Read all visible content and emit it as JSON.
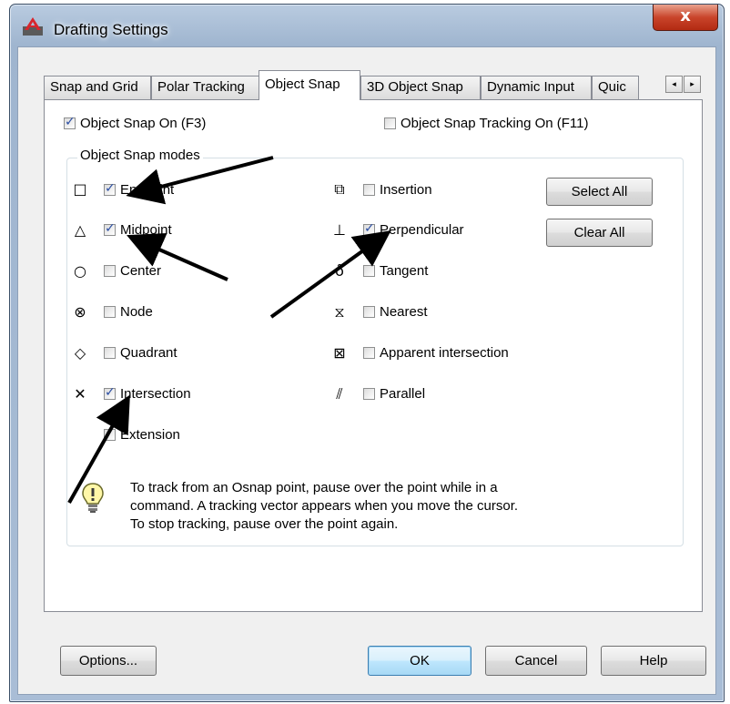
{
  "window": {
    "title": "Drafting Settings",
    "close_label": "x"
  },
  "tabs": [
    {
      "label": "Snap and Grid",
      "active": false
    },
    {
      "label": "Polar Tracking",
      "active": false
    },
    {
      "label": "Object Snap",
      "active": true
    },
    {
      "label": "3D Object Snap",
      "active": false
    },
    {
      "label": "Dynamic Input",
      "active": false
    },
    {
      "label": "Quic",
      "active": false
    }
  ],
  "tab_scroll": {
    "left": "◂",
    "right": "▸"
  },
  "object_snap": {
    "snap_on": {
      "label": "Object Snap On (F3)",
      "checked": true
    },
    "tracking_on": {
      "label": "Object Snap Tracking On (F11)",
      "checked": false
    },
    "group_label": "Object Snap modes",
    "modes_left": [
      {
        "label": "Endpoint",
        "checked": true,
        "symbol": "□",
        "icon": "square-icon"
      },
      {
        "label": "Midpoint",
        "checked": true,
        "symbol": "△",
        "icon": "triangle-icon"
      },
      {
        "label": "Center",
        "checked": false,
        "symbol": "○",
        "icon": "circle-icon"
      },
      {
        "label": "Node",
        "checked": false,
        "symbol": "⊗",
        "icon": "node-icon"
      },
      {
        "label": "Quadrant",
        "checked": false,
        "symbol": "◇",
        "icon": "diamond-icon"
      },
      {
        "label": "Intersection",
        "checked": true,
        "symbol": "✕",
        "icon": "x-icon"
      },
      {
        "label": "Extension",
        "checked": false,
        "symbol": "",
        "icon": ""
      }
    ],
    "modes_right": [
      {
        "label": "Insertion",
        "checked": false,
        "symbol": "⧉",
        "icon": "insertion-icon"
      },
      {
        "label": "Perpendicular",
        "checked": true,
        "symbol": "⊥",
        "icon": "perpendicular-icon"
      },
      {
        "label": "Tangent",
        "checked": false,
        "symbol": "ȏ",
        "icon": "tangent-icon"
      },
      {
        "label": "Nearest",
        "checked": false,
        "symbol": "⧖",
        "icon": "hourglass-icon"
      },
      {
        "label": "Apparent intersection",
        "checked": false,
        "symbol": "⊠",
        "icon": "boxed-x-icon"
      },
      {
        "label": "Parallel",
        "checked": false,
        "symbol": "⫽",
        "icon": "parallel-icon"
      }
    ],
    "select_all": "Select All",
    "clear_all": "Clear All",
    "tip_lines": [
      "To track from an Osnap point, pause over the point while in a",
      "command.  A tracking vector appears when you move the cursor.",
      "To stop tracking, pause over the point again."
    ]
  },
  "footer": {
    "options": "Options...",
    "ok": "OK",
    "cancel": "Cancel",
    "help": "Help"
  }
}
